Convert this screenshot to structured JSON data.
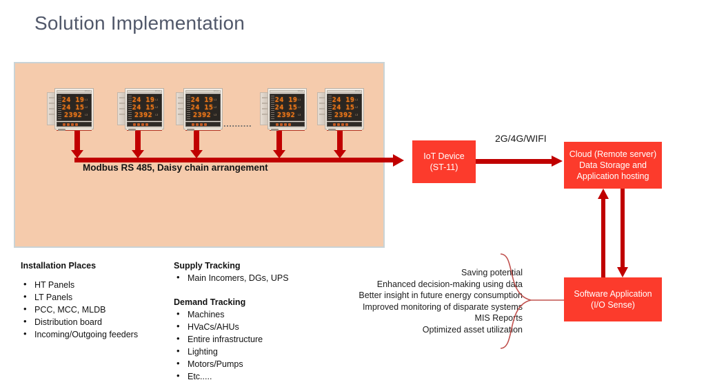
{
  "slide": {
    "title": "Solution Implementation"
  },
  "meter_panel": {
    "meters": [
      {
        "model": "ST-11",
        "rows": [
          "24 19",
          "24 15",
          "2392"
        ],
        "phases": [
          "L1",
          "L2",
          "L3"
        ]
      },
      {
        "model": "ST-11",
        "rows": [
          "24 19",
          "24 15",
          "2392"
        ],
        "phases": [
          "L1",
          "L2",
          "L3"
        ]
      },
      {
        "model": "ST-11",
        "rows": [
          "24 19",
          "24 15",
          "2392"
        ],
        "phases": [
          "L1",
          "L2",
          "L3"
        ]
      },
      {
        "model": "ST-11",
        "rows": [
          "24 19",
          "24 15",
          "2392"
        ],
        "phases": [
          "L1",
          "L2",
          "L3"
        ]
      },
      {
        "model": "ST-11",
        "rows": [
          "24 19",
          "24 15",
          "2392"
        ],
        "phases": [
          "L1",
          "L2",
          "L3"
        ]
      }
    ],
    "ellipsis": "..........",
    "bus_label": "Modbus RS 485, Daisy chain arrangement",
    "panel_color": "#F5CBAC",
    "bus_color": "#C00000"
  },
  "nodes": {
    "iot": {
      "line1": "IoT Device",
      "line2": "(ST-11)"
    },
    "cloud": {
      "line1": "Cloud (Remote server)",
      "line2": "Data Storage and",
      "line3": "Application hosting"
    },
    "app": {
      "line1": "Software Application",
      "line2": "(I/O Sense)"
    },
    "box_color": "#FC3B2C"
  },
  "links": {
    "cellular_label": "2G/4G/WIFI"
  },
  "installation": {
    "heading": "Installation Places",
    "items": [
      "HT Panels",
      "LT Panels",
      "PCC, MCC, MLDB",
      "Distribution board",
      "Incoming/Outgoing feeders"
    ]
  },
  "supply": {
    "heading": "Supply Tracking",
    "items": [
      "Main Incomers, DGs, UPS"
    ]
  },
  "demand": {
    "heading": "Demand Tracking",
    "items": [
      "Machines",
      "HVaCs/AHUs",
      "Entire infrastructure",
      "Lighting",
      "Motors/Pumps",
      "Etc....."
    ]
  },
  "benefits": {
    "items": [
      "Saving potential",
      "Enhanced decision-making using data",
      "Better insight in future energy consumption",
      "Improved monitoring of disparate systems",
      "MIS Reports",
      "Optimized asset utilization"
    ]
  }
}
